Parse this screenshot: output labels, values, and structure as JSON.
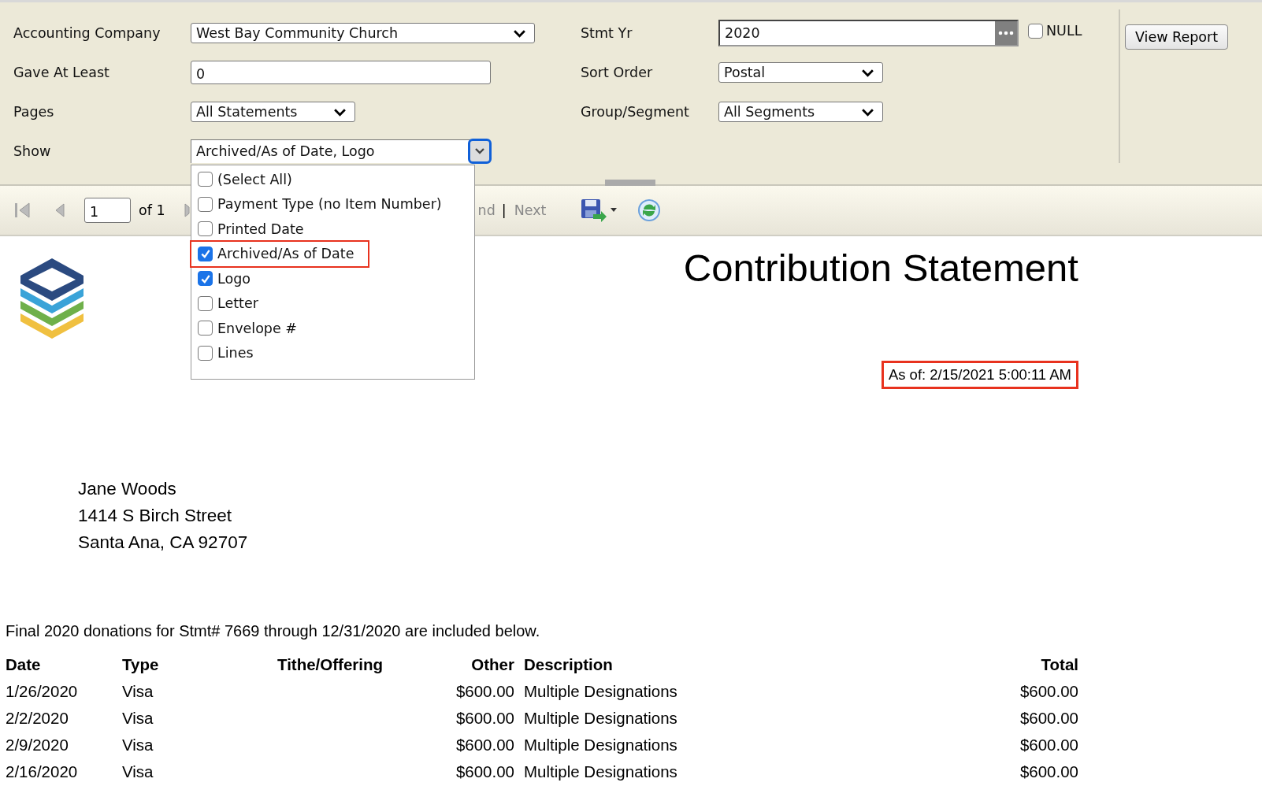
{
  "filters": {
    "accounting_company": {
      "label": "Accounting Company",
      "value": "West Bay Community Church"
    },
    "gave_at_least": {
      "label": "Gave At Least",
      "value": "0"
    },
    "pages": {
      "label": "Pages",
      "value": "All Statements"
    },
    "show": {
      "label": "Show",
      "value": "Archived/As of Date, Logo",
      "expanded": true
    },
    "stmt_yr": {
      "label": "Stmt Yr",
      "value": "2020"
    },
    "null_checkbox": {
      "label": "NULL",
      "checked": false
    },
    "sort_order": {
      "label": "Sort Order",
      "value": "Postal"
    },
    "group_segment": {
      "label": "Group/Segment",
      "value": "All Segments"
    }
  },
  "view_report_button": "View Report",
  "show_options": [
    {
      "label": "(Select All)",
      "checked": false,
      "highlighted": false
    },
    {
      "label": "Payment Type (no Item Number)",
      "checked": false,
      "highlighted": false
    },
    {
      "label": "Printed Date",
      "checked": false,
      "highlighted": false
    },
    {
      "label": "Archived/As of Date",
      "checked": true,
      "highlighted": true
    },
    {
      "label": "Logo",
      "checked": true,
      "highlighted": false
    },
    {
      "label": "Letter",
      "checked": false,
      "highlighted": false
    },
    {
      "label": "Envelope #",
      "checked": false,
      "highlighted": false
    },
    {
      "label": "Lines",
      "checked": false,
      "highlighted": false
    }
  ],
  "toolbar": {
    "page_value": "1",
    "page_count": "of 1",
    "find_partial": "nd",
    "separator": "|",
    "next": "Next"
  },
  "report": {
    "title": "Contribution Statement",
    "as_of": {
      "text": "As of: 2/15/2021 5:00:11 AM",
      "highlighted": true
    },
    "address": [
      "Jane Woods",
      "1414 S Birch Street",
      "Santa Ana, CA 92707"
    ],
    "intro": "Final 2020 donations for Stmt# 7669 through 12/31/2020 are included below.",
    "columns": [
      "Date",
      "Type",
      "Tithe/Offering",
      "Other",
      "Description",
      "Total"
    ],
    "rows": [
      [
        "1/26/2020",
        "Visa",
        "",
        "$600.00",
        "Multiple Designations",
        "$600.00"
      ],
      [
        "2/2/2020",
        "Visa",
        "",
        "$600.00",
        "Multiple Designations",
        "$600.00"
      ],
      [
        "2/9/2020",
        "Visa",
        "",
        "$600.00",
        "Multiple Designations",
        "$600.00"
      ],
      [
        "2/16/2020",
        "Visa",
        "",
        "$600.00",
        "Multiple Designations",
        "$600.00"
      ]
    ]
  }
}
